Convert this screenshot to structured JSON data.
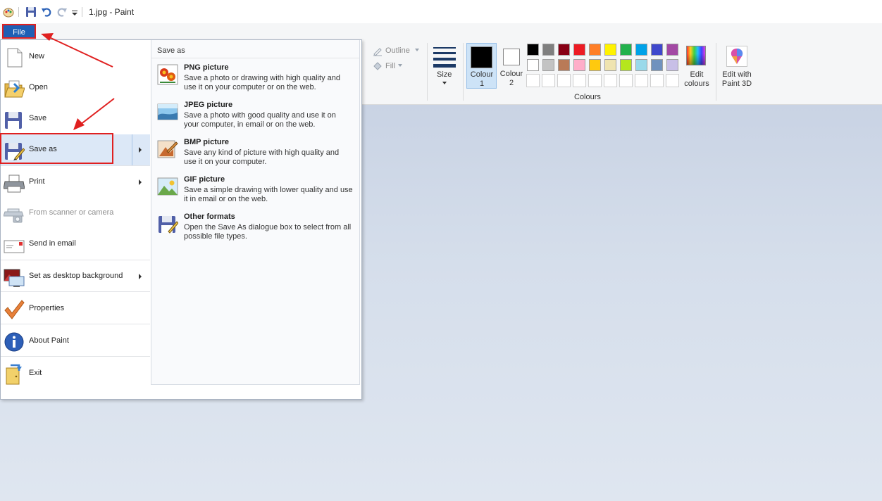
{
  "window": {
    "title": "1.jpg - Paint"
  },
  "file_tab": {
    "label": "File"
  },
  "ribbon": {
    "outline_label": "Outline",
    "fill_label": "Fill",
    "size_label": "Size",
    "colour1_label": "Colour\n1",
    "colour2_label": "Colour\n2",
    "edit_colours_label": "Edit colours",
    "edit_paint3d_label": "Edit with Paint 3D",
    "colours_group_label": "Colours",
    "palette_row1": [
      "#000000",
      "#7f7f7f",
      "#880015",
      "#ed1c24",
      "#ff7f27",
      "#fff200",
      "#22b14c",
      "#00a2e8",
      "#3f48cc",
      "#a349a4"
    ],
    "palette_row2": [
      "#ffffff",
      "#c3c3c3",
      "#b97a57",
      "#ffaec9",
      "#ffc90e",
      "#efe4b0",
      "#b5e61d",
      "#99d9ea",
      "#7092be",
      "#c8bfe7"
    ]
  },
  "file_menu": {
    "items": [
      {
        "label": "New"
      },
      {
        "label": "Open"
      },
      {
        "label": "Save"
      },
      {
        "label": "Save as"
      },
      {
        "label": "Print"
      },
      {
        "label": "From scanner or camera"
      },
      {
        "label": "Send in email"
      },
      {
        "label": "Set as desktop background"
      },
      {
        "label": "Properties"
      },
      {
        "label": "About Paint"
      },
      {
        "label": "Exit"
      }
    ]
  },
  "save_as_submenu": {
    "heading": "Save as",
    "items": [
      {
        "title": "PNG picture",
        "desc": "Save a photo or drawing with high quality and use it on your computer or on the web."
      },
      {
        "title": "JPEG picture",
        "desc": "Save a photo with good quality and use it on your computer, in email or on the web."
      },
      {
        "title": "BMP picture",
        "desc": "Save any kind of picture with high quality and use it on your computer."
      },
      {
        "title": "GIF picture",
        "desc": "Save a simple drawing with lower quality and use it in email or on the web."
      },
      {
        "title": "Other formats",
        "desc": "Open the Save As dialogue box to select from all possible file types."
      }
    ]
  }
}
